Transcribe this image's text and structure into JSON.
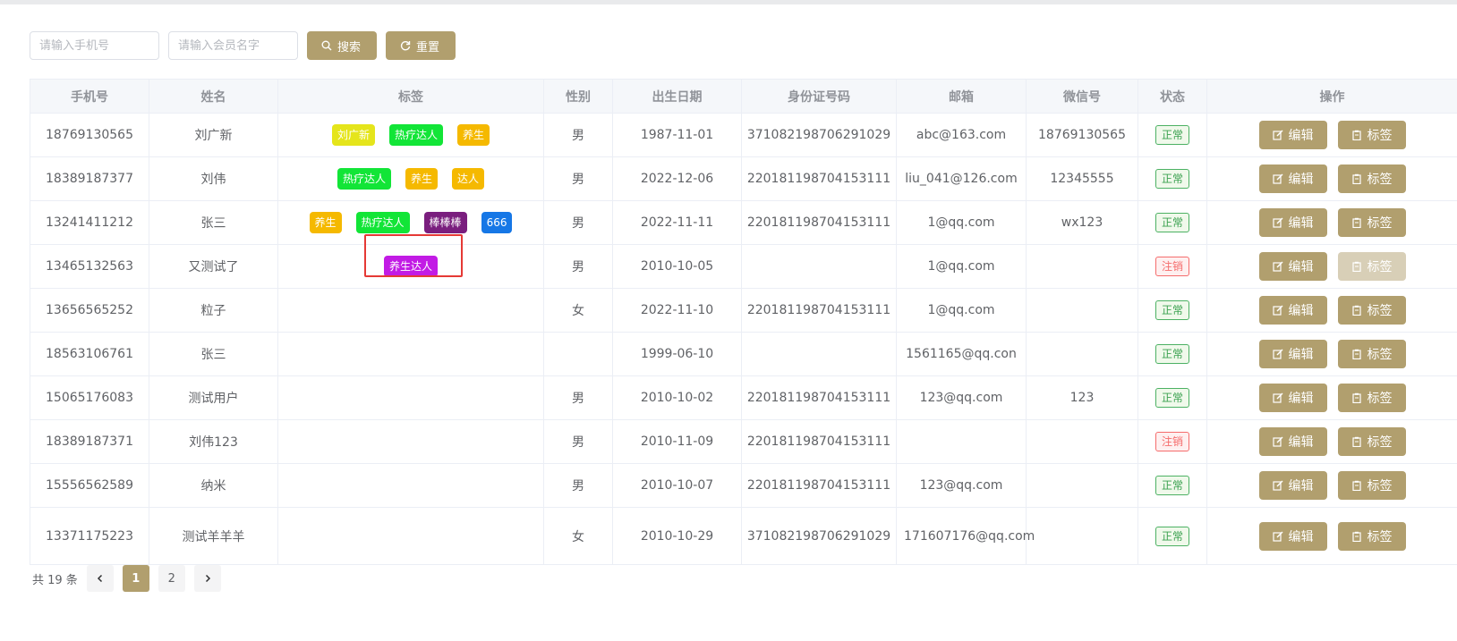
{
  "search": {
    "phone_placeholder": "请输入手机号",
    "name_placeholder": "请输入会员名字",
    "search_label": "搜索",
    "reset_label": "重置"
  },
  "table": {
    "headers": [
      "手机号",
      "姓名",
      "标签",
      "性别",
      "出生日期",
      "身份证号码",
      "邮箱",
      "微信号",
      "状态",
      "操作"
    ],
    "rows": [
      {
        "phone": "18769130565",
        "name": "刘广新",
        "tags": [
          {
            "text": "刘广新",
            "color": "#e5e51b"
          },
          {
            "text": "热疗达人",
            "color": "#12e537"
          },
          {
            "text": "养生",
            "color": "#f5b900"
          }
        ],
        "gender": "男",
        "birth": "1987-11-01",
        "idcard": "371082198706291029",
        "email": "abc@163.com",
        "wechat": "18769130565",
        "status": "正常",
        "status_type": "ok"
      },
      {
        "phone": "18389187377",
        "name": "刘伟",
        "tags": [
          {
            "text": "热疗达人",
            "color": "#12e537"
          },
          {
            "text": "养生",
            "color": "#f5b900"
          },
          {
            "text": "达人",
            "color": "#f5b900"
          }
        ],
        "gender": "男",
        "birth": "2022-12-06",
        "idcard": "220181198704153111",
        "email": "liu_041@126.com",
        "wechat": "12345555",
        "status": "正常",
        "status_type": "ok"
      },
      {
        "phone": "13241411212",
        "name": "张三",
        "tags": [
          {
            "text": "养生",
            "color": "#f5b900"
          },
          {
            "text": "热疗达人",
            "color": "#12e537"
          },
          {
            "text": "棒棒棒",
            "color": "#7a1e7e"
          },
          {
            "text": "666",
            "color": "#1677e6"
          }
        ],
        "gender": "男",
        "birth": "2022-11-11",
        "idcard": "220181198704153111",
        "email": "1@qq.com",
        "wechat": "wx123",
        "status": "正常",
        "status_type": "ok"
      },
      {
        "phone": "13465132563",
        "name": "又测试了",
        "tags": [
          {
            "text": "养生达人",
            "color": "#c21be5"
          }
        ],
        "gender": "男",
        "birth": "2010-10-05",
        "idcard": "",
        "email": "1@qq.com",
        "wechat": "",
        "status": "注销",
        "status_type": "bad",
        "tag_disabled": true
      },
      {
        "phone": "13656565252",
        "name": "粒子",
        "tags": [],
        "gender": "女",
        "birth": "2022-11-10",
        "idcard": "220181198704153111",
        "email": "1@qq.com",
        "wechat": "",
        "status": "正常",
        "status_type": "ok"
      },
      {
        "phone": "18563106761",
        "name": "张三",
        "tags": [],
        "gender": "",
        "birth": "1999-06-10",
        "idcard": "",
        "email": "1561165@qq.con",
        "wechat": "",
        "status": "正常",
        "status_type": "ok"
      },
      {
        "phone": "15065176083",
        "name": "测试用户",
        "tags": [],
        "gender": "男",
        "birth": "2010-10-02",
        "idcard": "220181198704153111",
        "email": "123@qq.com",
        "wechat": "123",
        "status": "正常",
        "status_type": "ok"
      },
      {
        "phone": "18389187371",
        "name": "刘伟123",
        "tags": [],
        "gender": "男",
        "birth": "2010-11-09",
        "idcard": "220181198704153111",
        "email": "",
        "wechat": "",
        "status": "注销",
        "status_type": "bad"
      },
      {
        "phone": "15556562589",
        "name": "纳米",
        "tags": [],
        "gender": "男",
        "birth": "2010-10-07",
        "idcard": "220181198704153111",
        "email": "123@qq.com",
        "wechat": "",
        "status": "正常",
        "status_type": "ok"
      },
      {
        "phone": "13371175223",
        "name": "测试羊羊羊",
        "tags": [],
        "gender": "女",
        "birth": "2010-10-29",
        "idcard": "371082198706291029",
        "email": "171607176@qq.com",
        "wechat": "",
        "status": "正常",
        "status_type": "ok"
      }
    ],
    "edit_label": "编辑",
    "tag_label": "标签"
  },
  "pager": {
    "total_text": "共 19 条",
    "pages": [
      "1",
      "2"
    ],
    "current": "1"
  },
  "colors": {
    "accent": "#b19f6e"
  }
}
